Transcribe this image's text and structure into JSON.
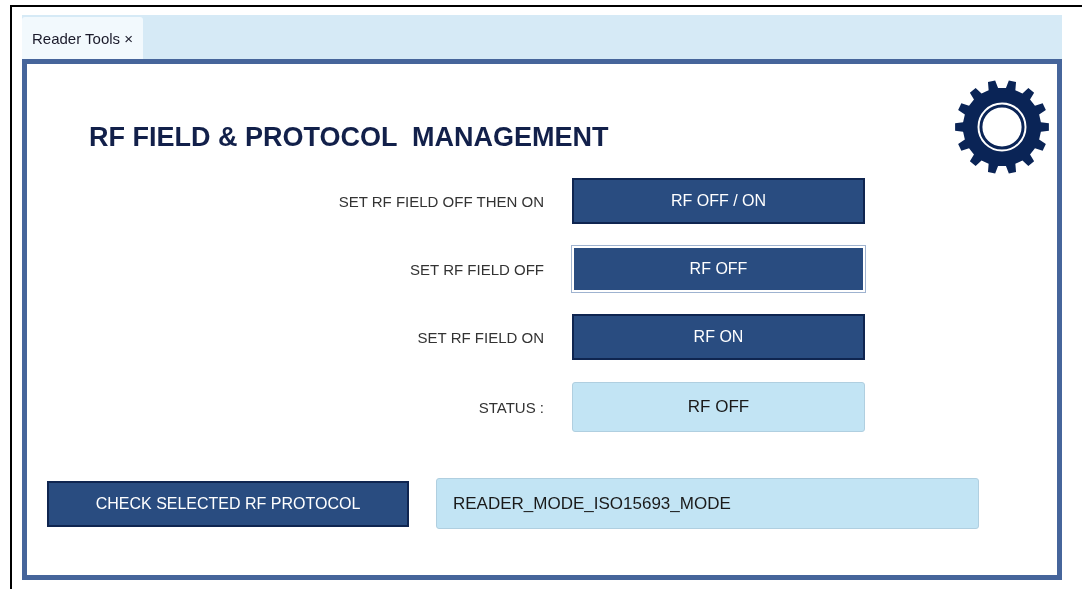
{
  "tabs": [
    {
      "label": "Reader Tools",
      "close": "×",
      "selected": true
    }
  ],
  "title": "RF FIELD & PROTOCOL  MANAGEMENT",
  "rows": [
    {
      "kind": "button",
      "label": "SET RF FIELD OFF THEN ON",
      "value": "RF OFF / ON",
      "focused": false
    },
    {
      "kind": "button",
      "label": "SET RF FIELD OFF",
      "value": "RF OFF",
      "focused": true
    },
    {
      "kind": "button",
      "label": "SET RF FIELD ON",
      "value": "RF ON",
      "focused": false
    },
    {
      "kind": "status",
      "label": "STATUS :",
      "value": "RF OFF"
    }
  ],
  "protocol": {
    "button": "CHECK SELECTED RF PROTOCOL",
    "value": "READER_MODE_ISO15693_MODE"
  }
}
